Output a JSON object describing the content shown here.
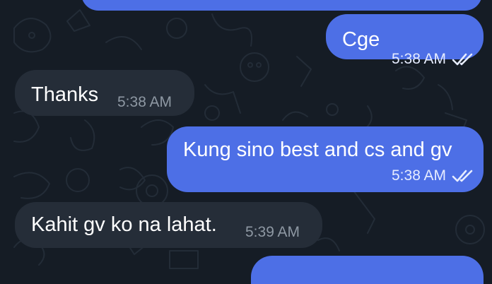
{
  "messages": [
    {
      "direction": "out",
      "text": "",
      "time": "",
      "read": false
    },
    {
      "direction": "out",
      "text": "Cge",
      "time": "5:38 AM",
      "read": true
    },
    {
      "direction": "in",
      "text": "Thanks",
      "time": "5:38 AM"
    },
    {
      "direction": "out",
      "text": "Kung sino best and cs and gv",
      "time": "5:38 AM",
      "read": true
    },
    {
      "direction": "in",
      "text": "Kahit gv ko na lahat.",
      "time": "5:39 AM"
    },
    {
      "direction": "out",
      "text": "",
      "time": "",
      "read": false
    }
  ],
  "colors": {
    "background": "#151c25",
    "outgoing_bubble": "#4d6fe6",
    "incoming_bubble": "#252d38",
    "incoming_meta": "#8e98a3"
  },
  "icons": {
    "read_receipt": "double-check-icon"
  }
}
